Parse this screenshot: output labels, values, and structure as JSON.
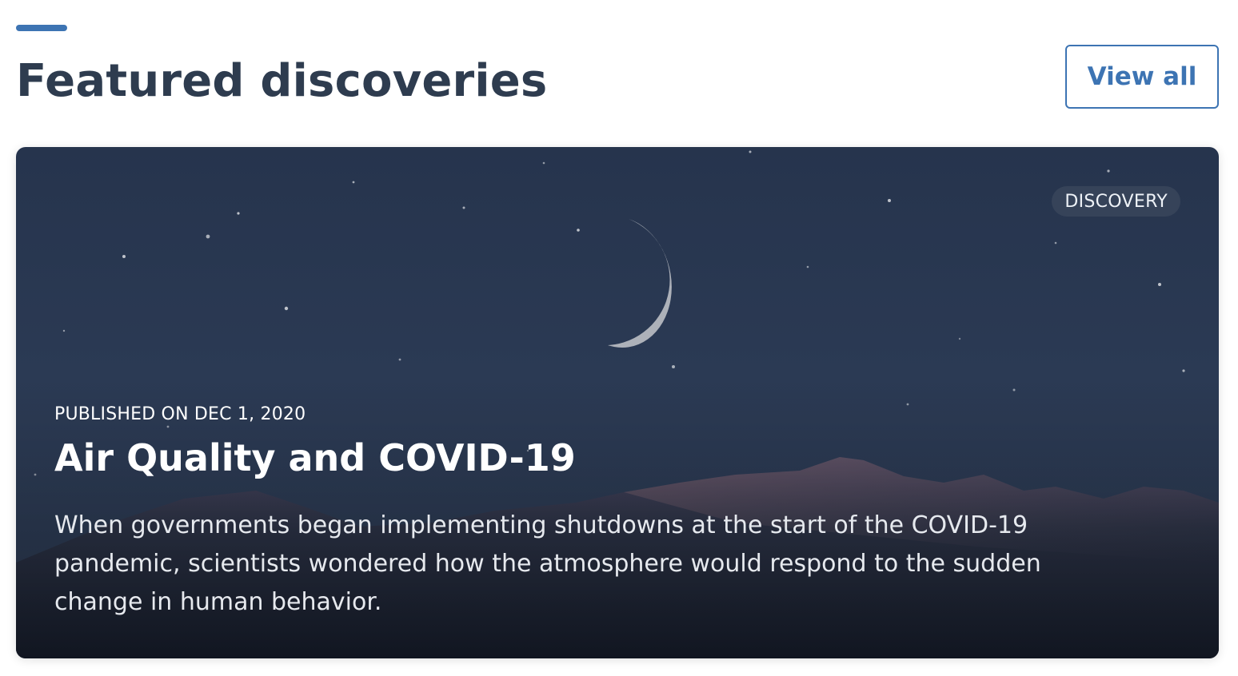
{
  "section": {
    "title": "Featured discoveries",
    "view_all_label": "View all"
  },
  "featured_card": {
    "badge": "DISCOVERY",
    "published": "PUBLISHED ON DEC 1, 2020",
    "title": "Air Quality and COVID-19",
    "description": "When governments began implementing shutdowns at the start of the COVID-19 pandemic, scientists wondered how the atmosphere would respond to the sudden change in human behavior.",
    "background_image": "night-sky-crescent-moon-snowy-mountains"
  },
  "colors": {
    "accent": "#3d74b3",
    "heading": "#2e3c4f",
    "card_sky": "#2b3a54"
  }
}
